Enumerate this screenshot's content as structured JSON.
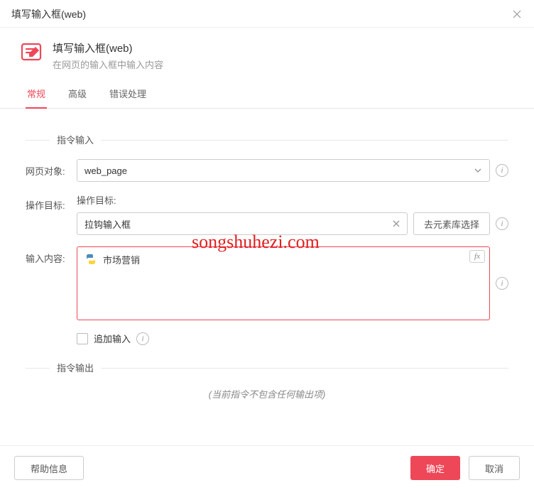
{
  "window": {
    "title": "填写输入框(web)"
  },
  "header": {
    "title": "填写输入框(web)",
    "subtitle": "在网页的输入框中输入内容"
  },
  "tabs": {
    "general": "常规",
    "advanced": "高级",
    "error": "错误处理"
  },
  "section": {
    "input": "指令输入",
    "output": "指令输出"
  },
  "fields": {
    "web_object": {
      "label": "网页对象:",
      "value": "web_page"
    },
    "target": {
      "label": "操作目标:",
      "sub_label": "操作目标:",
      "value": "拉钩输入框",
      "select_btn": "去元素库选择"
    },
    "content": {
      "label": "输入内容:",
      "value": "市场营销",
      "fx": "fx"
    },
    "append": {
      "label": "追加输入"
    }
  },
  "output_empty": "(当前指令不包含任何输出项)",
  "footer": {
    "help": "帮助信息",
    "ok": "确定",
    "cancel": "取消"
  },
  "watermark": "songshuhezi.com"
}
